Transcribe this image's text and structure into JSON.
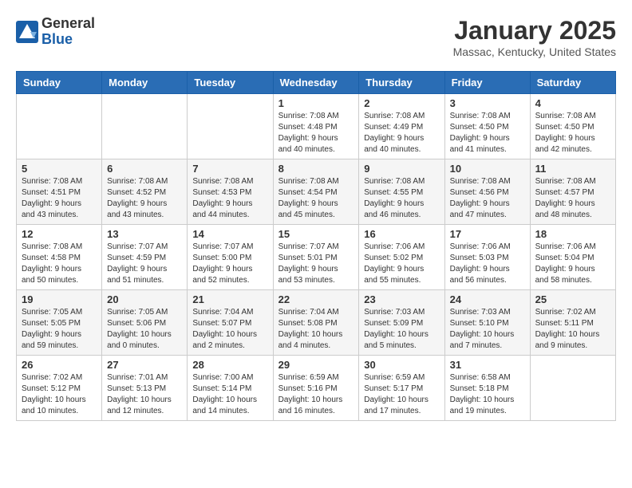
{
  "header": {
    "logo_general": "General",
    "logo_blue": "Blue",
    "month": "January 2025",
    "location": "Massac, Kentucky, United States"
  },
  "days_of_week": [
    "Sunday",
    "Monday",
    "Tuesday",
    "Wednesday",
    "Thursday",
    "Friday",
    "Saturday"
  ],
  "weeks": [
    [
      {
        "day": "",
        "content": ""
      },
      {
        "day": "",
        "content": ""
      },
      {
        "day": "",
        "content": ""
      },
      {
        "day": "1",
        "content": "Sunrise: 7:08 AM\nSunset: 4:48 PM\nDaylight: 9 hours\nand 40 minutes."
      },
      {
        "day": "2",
        "content": "Sunrise: 7:08 AM\nSunset: 4:49 PM\nDaylight: 9 hours\nand 40 minutes."
      },
      {
        "day": "3",
        "content": "Sunrise: 7:08 AM\nSunset: 4:50 PM\nDaylight: 9 hours\nand 41 minutes."
      },
      {
        "day": "4",
        "content": "Sunrise: 7:08 AM\nSunset: 4:50 PM\nDaylight: 9 hours\nand 42 minutes."
      }
    ],
    [
      {
        "day": "5",
        "content": "Sunrise: 7:08 AM\nSunset: 4:51 PM\nDaylight: 9 hours\nand 43 minutes."
      },
      {
        "day": "6",
        "content": "Sunrise: 7:08 AM\nSunset: 4:52 PM\nDaylight: 9 hours\nand 43 minutes."
      },
      {
        "day": "7",
        "content": "Sunrise: 7:08 AM\nSunset: 4:53 PM\nDaylight: 9 hours\nand 44 minutes."
      },
      {
        "day": "8",
        "content": "Sunrise: 7:08 AM\nSunset: 4:54 PM\nDaylight: 9 hours\nand 45 minutes."
      },
      {
        "day": "9",
        "content": "Sunrise: 7:08 AM\nSunset: 4:55 PM\nDaylight: 9 hours\nand 46 minutes."
      },
      {
        "day": "10",
        "content": "Sunrise: 7:08 AM\nSunset: 4:56 PM\nDaylight: 9 hours\nand 47 minutes."
      },
      {
        "day": "11",
        "content": "Sunrise: 7:08 AM\nSunset: 4:57 PM\nDaylight: 9 hours\nand 48 minutes."
      }
    ],
    [
      {
        "day": "12",
        "content": "Sunrise: 7:08 AM\nSunset: 4:58 PM\nDaylight: 9 hours\nand 50 minutes."
      },
      {
        "day": "13",
        "content": "Sunrise: 7:07 AM\nSunset: 4:59 PM\nDaylight: 9 hours\nand 51 minutes."
      },
      {
        "day": "14",
        "content": "Sunrise: 7:07 AM\nSunset: 5:00 PM\nDaylight: 9 hours\nand 52 minutes."
      },
      {
        "day": "15",
        "content": "Sunrise: 7:07 AM\nSunset: 5:01 PM\nDaylight: 9 hours\nand 53 minutes."
      },
      {
        "day": "16",
        "content": "Sunrise: 7:06 AM\nSunset: 5:02 PM\nDaylight: 9 hours\nand 55 minutes."
      },
      {
        "day": "17",
        "content": "Sunrise: 7:06 AM\nSunset: 5:03 PM\nDaylight: 9 hours\nand 56 minutes."
      },
      {
        "day": "18",
        "content": "Sunrise: 7:06 AM\nSunset: 5:04 PM\nDaylight: 9 hours\nand 58 minutes."
      }
    ],
    [
      {
        "day": "19",
        "content": "Sunrise: 7:05 AM\nSunset: 5:05 PM\nDaylight: 9 hours\nand 59 minutes."
      },
      {
        "day": "20",
        "content": "Sunrise: 7:05 AM\nSunset: 5:06 PM\nDaylight: 10 hours\nand 0 minutes."
      },
      {
        "day": "21",
        "content": "Sunrise: 7:04 AM\nSunset: 5:07 PM\nDaylight: 10 hours\nand 2 minutes."
      },
      {
        "day": "22",
        "content": "Sunrise: 7:04 AM\nSunset: 5:08 PM\nDaylight: 10 hours\nand 4 minutes."
      },
      {
        "day": "23",
        "content": "Sunrise: 7:03 AM\nSunset: 5:09 PM\nDaylight: 10 hours\nand 5 minutes."
      },
      {
        "day": "24",
        "content": "Sunrise: 7:03 AM\nSunset: 5:10 PM\nDaylight: 10 hours\nand 7 minutes."
      },
      {
        "day": "25",
        "content": "Sunrise: 7:02 AM\nSunset: 5:11 PM\nDaylight: 10 hours\nand 9 minutes."
      }
    ],
    [
      {
        "day": "26",
        "content": "Sunrise: 7:02 AM\nSunset: 5:12 PM\nDaylight: 10 hours\nand 10 minutes."
      },
      {
        "day": "27",
        "content": "Sunrise: 7:01 AM\nSunset: 5:13 PM\nDaylight: 10 hours\nand 12 minutes."
      },
      {
        "day": "28",
        "content": "Sunrise: 7:00 AM\nSunset: 5:14 PM\nDaylight: 10 hours\nand 14 minutes."
      },
      {
        "day": "29",
        "content": "Sunrise: 6:59 AM\nSunset: 5:16 PM\nDaylight: 10 hours\nand 16 minutes."
      },
      {
        "day": "30",
        "content": "Sunrise: 6:59 AM\nSunset: 5:17 PM\nDaylight: 10 hours\nand 17 minutes."
      },
      {
        "day": "31",
        "content": "Sunrise: 6:58 AM\nSunset: 5:18 PM\nDaylight: 10 hours\nand 19 minutes."
      },
      {
        "day": "",
        "content": ""
      }
    ]
  ]
}
